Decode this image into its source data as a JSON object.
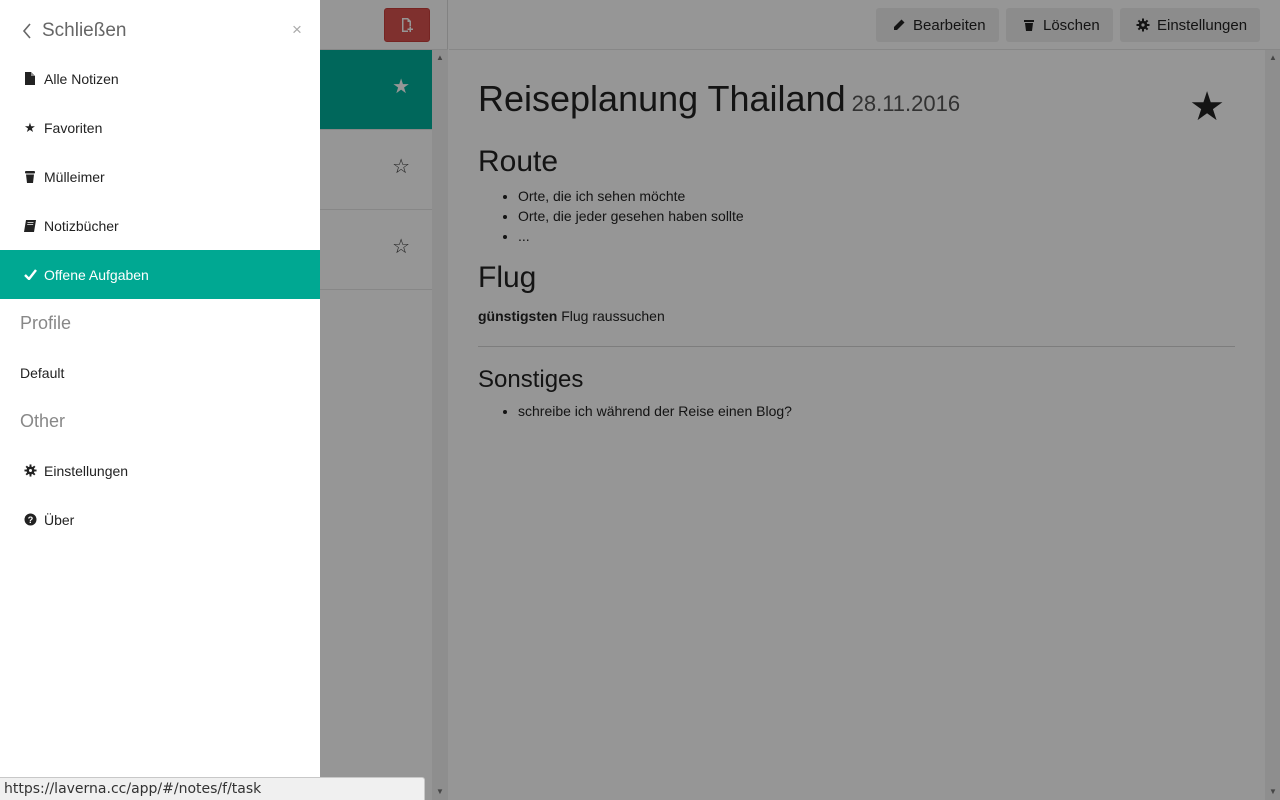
{
  "sidebar": {
    "close_label": "Schließen",
    "close_x": "×",
    "nav_items": [
      {
        "label": "Alle Notizen",
        "icon": "file-icon"
      },
      {
        "label": "Favoriten",
        "icon": "star-icon"
      },
      {
        "label": "Mülleimer",
        "icon": "trash-icon"
      },
      {
        "label": "Notizbücher",
        "icon": "book-icon"
      },
      {
        "label": "Offene Aufgaben",
        "icon": "check-icon",
        "active": true
      }
    ],
    "profile_heading": "Profile",
    "profile_default": "Default",
    "other_heading": "Other",
    "other_items": [
      {
        "label": "Einstellungen",
        "icon": "gear-icon"
      },
      {
        "label": "Über",
        "icon": "question-circle-icon"
      }
    ]
  },
  "toolbar": {
    "edit_label": "Bearbeiten",
    "delete_label": "Löschen",
    "settings_label": "Einstellungen"
  },
  "note_list": {
    "items": [
      {
        "starred": true,
        "active": true,
        "star": "★"
      },
      {
        "starred": false,
        "active": false,
        "star": "☆"
      },
      {
        "starred": false,
        "active": false,
        "star": "☆"
      }
    ]
  },
  "note": {
    "title": "Reiseplanung Thailand",
    "date": "28.11.2016",
    "star": "★",
    "route_heading": "Route",
    "route_items": [
      "Orte, die ich sehen möchte",
      "Orte, die jeder gesehen haben sollte",
      "..."
    ],
    "flug_heading": "Flug",
    "flug_bold": "günstigsten",
    "flug_text": " Flug raussuchen",
    "sonstiges_heading": "Sonstiges",
    "sonstiges_items": [
      "schreibe ich während der Reise einen Blog?"
    ]
  },
  "statusbar": {
    "url": "https://laverna.cc/app/#/notes/f/task"
  },
  "colors": {
    "accent": "#00a892",
    "danger": "#d9534f"
  }
}
